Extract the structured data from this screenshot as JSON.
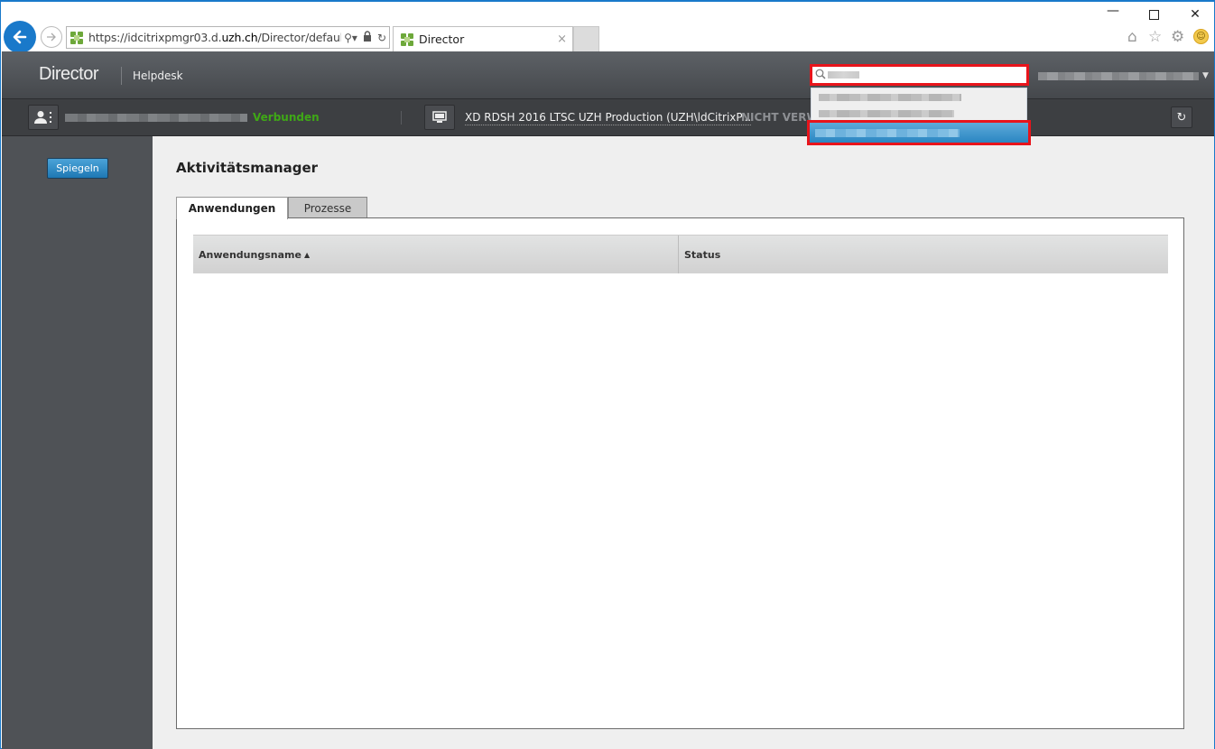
{
  "browser": {
    "url_prefix": "https://idcitrixpmgr03.d.",
    "url_domain": "uzh.ch",
    "url_suffix": "/Director/default.h",
    "tab_title": "Director",
    "tab_close": "×",
    "window_controls": {
      "minimize": "—",
      "close": "✕"
    },
    "icons": {
      "back": "back-arrow-icon",
      "forward": "forward-arrow-icon",
      "search": "search-icon",
      "lock": "lock-icon",
      "refresh": "refresh-icon",
      "home": "home-icon",
      "favorites": "star-icon",
      "settings": "gear-icon",
      "feedback": "smiley-icon"
    }
  },
  "app": {
    "brand": "Director",
    "nav": {
      "helpdesk": "Helpdesk"
    },
    "search": {
      "value": "",
      "selected_index": 2,
      "results_count": 3
    },
    "context": {
      "user_status": "Verbunden",
      "machine_name": "XD RDSH 2016 LTSC UZH Production (UZH\\ldCitrixP...",
      "machine_state": "NICHT VERW"
    },
    "colors": {
      "accent_blue": "#1e78b4",
      "connected_green": "#3fa816",
      "highlight_red": "#e8141b",
      "header_dark": "#45484c"
    }
  },
  "sidebar": {
    "mirror_button": "Spiegeln"
  },
  "main": {
    "title": "Aktivitätsmanager",
    "tabs": [
      {
        "label": "Anwendungen",
        "active": true
      },
      {
        "label": "Prozesse",
        "active": false
      }
    ],
    "table": {
      "columns": [
        {
          "label": "Anwendungsname",
          "sort": "ascending"
        },
        {
          "label": "Status"
        }
      ],
      "rows": []
    }
  }
}
